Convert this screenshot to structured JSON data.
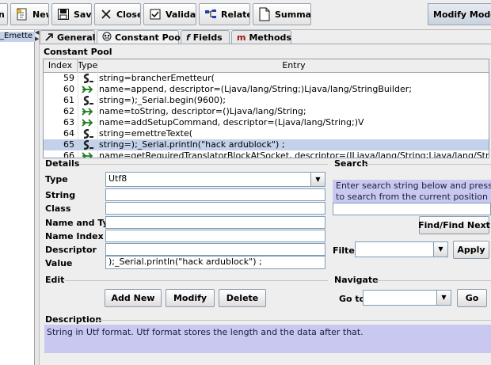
{
  "toolbar": {
    "partial_left": "n",
    "new_label": "New",
    "save_label": "Save",
    "close_label": "Close",
    "validate_label": "Validate",
    "related_label": "Related",
    "summary_label": "Summary",
    "mode_label": "Modify Mode (C"
  },
  "tree": {
    "selected_item": "_Emette"
  },
  "tabs": [
    {
      "label": "General",
      "icon": "arrow-icon"
    },
    {
      "label": "Constant Pool",
      "icon": "pool-icon"
    },
    {
      "label": "Fields",
      "icon": "field-icon"
    },
    {
      "label": "Methods",
      "icon": "method-icon"
    }
  ],
  "constant_pool": {
    "title": "Constant Pool",
    "columns": [
      "Index",
      "Type",
      "Entry"
    ],
    "rows": [
      {
        "index": "59",
        "type": "string",
        "entry": "string=brancherEmetteur("
      },
      {
        "index": "60",
        "type": "name-type",
        "entry": "name=append, descriptor=(Ljava/lang/String;)Ljava/lang/StringBuilder;"
      },
      {
        "index": "61",
        "type": "string",
        "entry": "string=);_Serial.begin(9600);"
      },
      {
        "index": "62",
        "type": "name-type",
        "entry": "name=toString, descriptor=()Ljava/lang/String;"
      },
      {
        "index": "63",
        "type": "name-type",
        "entry": "name=addSetupCommand, descriptor=(Ljava/lang/String;)V"
      },
      {
        "index": "64",
        "type": "string",
        "entry": "string=emettreTexte("
      },
      {
        "index": "65",
        "type": "string",
        "entry": "string=);_Serial.println(\"hack ardublock\") ;"
      },
      {
        "index": "66",
        "type": "name-type",
        "entry": "name=getRequiredTranslatorBlockAtSocket, descriptor=(ILjava/lang/String;Ljava/lang/String;)Lcom/ar"
      }
    ],
    "selected_index": "65"
  },
  "details": {
    "title": "Details",
    "type_label": "Type",
    "type_value": "Utf8",
    "string_label": "String",
    "class_label": "Class",
    "name_and_type_label": "Name and Type",
    "name_index_label": "Name Index",
    "descriptor_label": "Descriptor",
    "value_label": "Value",
    "value": ");_Serial.println(\"hack ardublock\") ;"
  },
  "search": {
    "title": "Search",
    "hint_line1": "Enter search string below and press Find",
    "hint_line2": "to search from the current position",
    "find_label": "Find/Find Next",
    "filter_label": "Filter",
    "apply_label": "Apply"
  },
  "edit": {
    "title": "Edit",
    "add_new_label": "Add New",
    "modify_label": "Modify",
    "delete_label": "Delete"
  },
  "navigate": {
    "title": "Navigate",
    "goto_label": "Go to",
    "go_label": "Go"
  },
  "description": {
    "title": "Description",
    "text": "String in Utf format. Utf format stores the length and the data after that."
  },
  "colors": {
    "selection": "#c3d2ea",
    "hint_background": "#c8c8f0",
    "string_icon": "#222222",
    "name_type_icon": "#1c7a1c",
    "method_icon": "#a01010"
  }
}
